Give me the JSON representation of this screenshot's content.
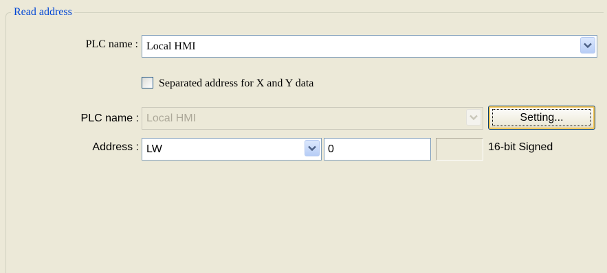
{
  "group": {
    "title": "Read address"
  },
  "plc_row_1": {
    "label": "PLC name :",
    "value": "Local HMI"
  },
  "separated_checkbox": {
    "label": "Separated address for X and Y data",
    "checked": false
  },
  "plc_row_2": {
    "label": "PLC name :",
    "value": "Local HMI",
    "setting_button": "Setting..."
  },
  "address_row": {
    "label": "Address :",
    "device": "LW",
    "value": "0",
    "data_type": "16-bit Signed"
  },
  "colors": {
    "group_title": "#0046d5",
    "window_bg": "#ece9d8",
    "field_border": "#7f9db9"
  },
  "icons": {
    "dropdown": "chevron-down-icon",
    "checkbox": "checkbox-unchecked-icon"
  }
}
